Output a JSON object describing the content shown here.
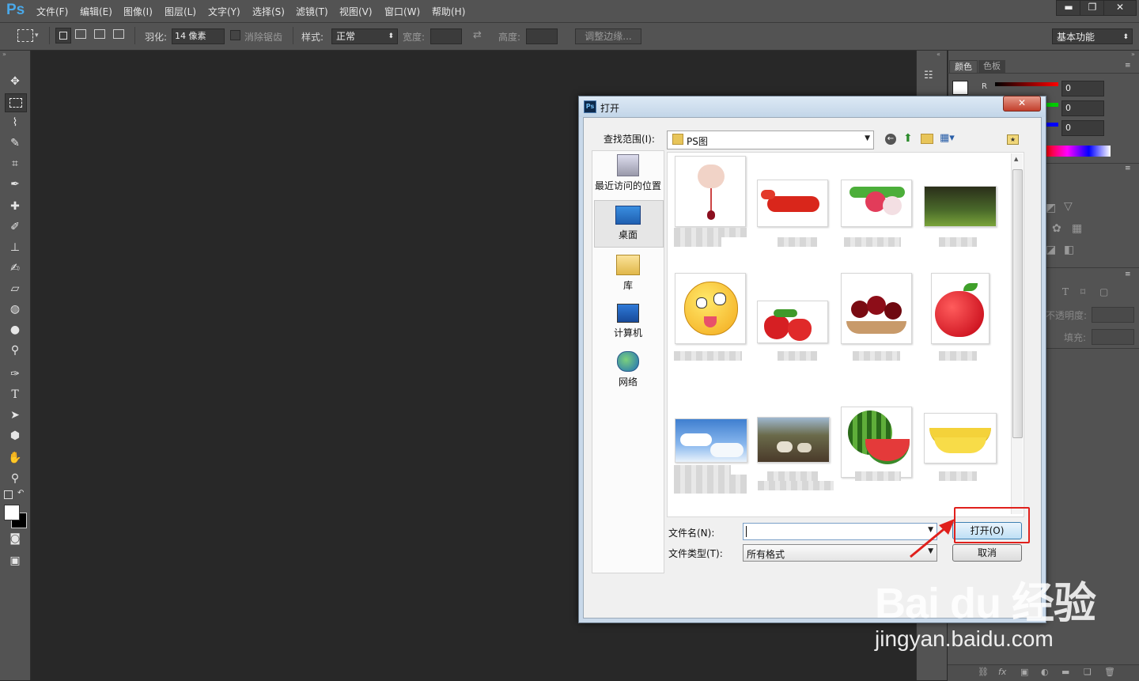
{
  "app": {
    "logo": "Ps"
  },
  "menu": [
    "文件(F)",
    "编辑(E)",
    "图像(I)",
    "图层(L)",
    "文字(Y)",
    "选择(S)",
    "滤镜(T)",
    "视图(V)",
    "窗口(W)",
    "帮助(H)"
  ],
  "window_buttons": {
    "minimize": "▬",
    "restore": "❐",
    "close": "✕"
  },
  "options": {
    "feather_label": "羽化:",
    "feather_value": "14 像素",
    "antialias_label": "消除锯齿",
    "style_label": "样式:",
    "style_value": "正常",
    "width_label": "宽度:",
    "height_label": "高度:",
    "refine_edge": "调整边缘...",
    "workspace": "基本功能"
  },
  "panels": {
    "tabs": [
      "颜色",
      "色板"
    ],
    "channels": [
      {
        "label": "R",
        "value": "0"
      },
      {
        "label": "",
        "value": "0"
      },
      {
        "label": "",
        "value": "0"
      }
    ],
    "opacity_label": "不透明度:",
    "fill_label": "填充:"
  },
  "dialog": {
    "title": "打开",
    "lookin_label": "查找范围(I):",
    "lookin_value": "PS图",
    "places": [
      "最近访问的位置",
      "桌面",
      "库",
      "计算机",
      "网络"
    ],
    "filename_label": "文件名(N):",
    "filename_value": "",
    "filetype_label": "文件类型(T):",
    "filetype_value": "所有格式",
    "open_button": "打开(O)",
    "cancel_button": "取消"
  },
  "watermark": {
    "brand": "Bai du 经验",
    "url": "jingyan.baidu.com"
  },
  "colors": {
    "highlight_box": "#e0201c",
    "arrow": "#e0201c"
  }
}
